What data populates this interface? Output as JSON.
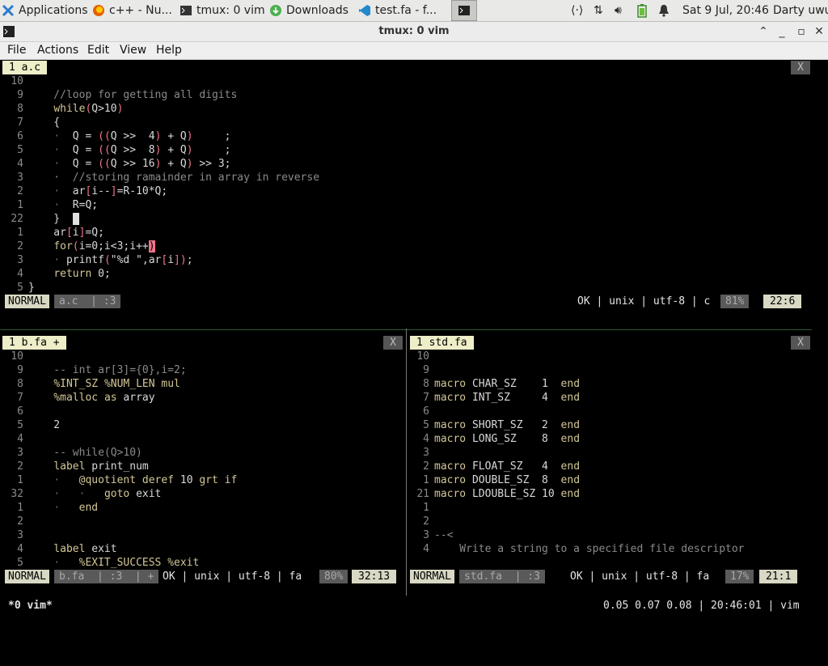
{
  "taskbar": {
    "tasks": [
      {
        "label": "Applications ☰"
      },
      {
        "label": "c++ - Nu..."
      },
      {
        "label": "tmux: 0 vim"
      },
      {
        "label": "Downloads"
      },
      {
        "label": "test.fa - f..."
      }
    ],
    "clock": "Sat  9 Jul, 20:46",
    "user": "Darty uwu"
  },
  "window": {
    "title": "tmux: 0 vim"
  },
  "menu": {
    "file": "File",
    "actions": "Actions",
    "edit": "Edit",
    "view": "View",
    "help": "Help"
  },
  "top_pane": {
    "tab": "1 a.c",
    "close": "X",
    "lines": [
      {
        "n": "10",
        "t": ""
      },
      {
        "n": "9",
        "t": "    //loop for getting all digits"
      },
      {
        "n": "8",
        "t": "    while(Q>10)"
      },
      {
        "n": "7",
        "t": "    {"
      },
      {
        "n": "6",
        "t": "    ·  Q = ((Q >>  4) + Q)     ;"
      },
      {
        "n": "5",
        "t": "    ·  Q = ((Q >>  8) + Q)     ;"
      },
      {
        "n": "4",
        "t": "    ·  Q = ((Q >> 16) + Q) >> 3;"
      },
      {
        "n": "3",
        "t": "    ·  //storing ramainder in array in reverse"
      },
      {
        "n": "2",
        "t": "    ·  ar[i--]=R-10*Q;"
      },
      {
        "n": "1",
        "t": "    ·  R=Q;"
      },
      {
        "n": "22",
        "t": "    }  "
      },
      {
        "n": "1",
        "t": "    ar[i]=Q;"
      },
      {
        "n": "2",
        "t": "    for(i=0;i<3;i++)"
      },
      {
        "n": "3",
        "t": "    · printf(\"%d \",ar[i]);"
      },
      {
        "n": "4",
        "t": "    return 0;"
      },
      {
        "n": "5",
        "t": "}"
      }
    ],
    "status": {
      "mode": "NORMAL",
      "file": "a.c  | :3",
      "info": "OK | unix | utf-8 | c",
      "pct": "81%",
      "pos": "22:6"
    }
  },
  "left_pane": {
    "tab": "1 b.fa +",
    "close": "X",
    "lines": [
      {
        "n": "10",
        "t": ""
      },
      {
        "n": "9",
        "t": "    -- int ar[3]={0},i=2;"
      },
      {
        "n": "8",
        "t": "    %INT_SZ %NUM_LEN mul"
      },
      {
        "n": "7",
        "t": "    %malloc as array"
      },
      {
        "n": "6",
        "t": ""
      },
      {
        "n": "5",
        "t": "    2"
      },
      {
        "n": "4",
        "t": ""
      },
      {
        "n": "3",
        "t": "    -- while(Q>10)"
      },
      {
        "n": "2",
        "t": "    label print_num"
      },
      {
        "n": "1",
        "t": "    ·   @quotient deref 10 grt if"
      },
      {
        "n": "32",
        "t": "    ·   ·   goto exit"
      },
      {
        "n": "1",
        "t": "    ·   end"
      },
      {
        "n": "2",
        "t": ""
      },
      {
        "n": "3",
        "t": ""
      },
      {
        "n": "4",
        "t": "    label exit"
      },
      {
        "n": "5",
        "t": "    ·   %EXIT_SUCCESS %exit"
      }
    ],
    "status": {
      "mode": "NORMAL",
      "file": "b.fa  | :3  | +",
      "info": "OK | unix | utf-8 | fa",
      "pct": "80%",
      "pos": "32:13"
    }
  },
  "right_pane": {
    "tab": "1 std.fa",
    "close": "X",
    "lines": [
      {
        "n": "10",
        "t": ""
      },
      {
        "n": "9",
        "t": ""
      },
      {
        "n": "8",
        "t": "macro CHAR_SZ    1  end"
      },
      {
        "n": "7",
        "t": "macro INT_SZ     4  end"
      },
      {
        "n": "6",
        "t": ""
      },
      {
        "n": "5",
        "t": "macro SHORT_SZ   2  end"
      },
      {
        "n": "4",
        "t": "macro LONG_SZ    8  end"
      },
      {
        "n": "3",
        "t": ""
      },
      {
        "n": "2",
        "t": "macro FLOAT_SZ   4  end"
      },
      {
        "n": "1",
        "t": "macro DOUBLE_SZ  8  end"
      },
      {
        "n": "21",
        "t": "macro LDOUBLE_SZ 10 end"
      },
      {
        "n": "1",
        "t": ""
      },
      {
        "n": "2",
        "t": ""
      },
      {
        "n": "3",
        "t": "--<"
      },
      {
        "n": "4",
        "t": "    Write a string to a specified file descriptor"
      }
    ],
    "status": {
      "mode": "NORMAL",
      "file": "std.fa  | :3",
      "info": "OK | unix | utf-8 | fa",
      "pct": "17%",
      "pos": "21:1"
    }
  },
  "tmux": {
    "window": "*0 vim*",
    "right": "0.05 0.07 0.08 | 20:46:01 | vim"
  },
  "colors": {
    "tab_bg": "#eeeec8",
    "normal_bg": "#d8d8c4",
    "paren": "#f0768b",
    "keyword": "#d3c796"
  }
}
